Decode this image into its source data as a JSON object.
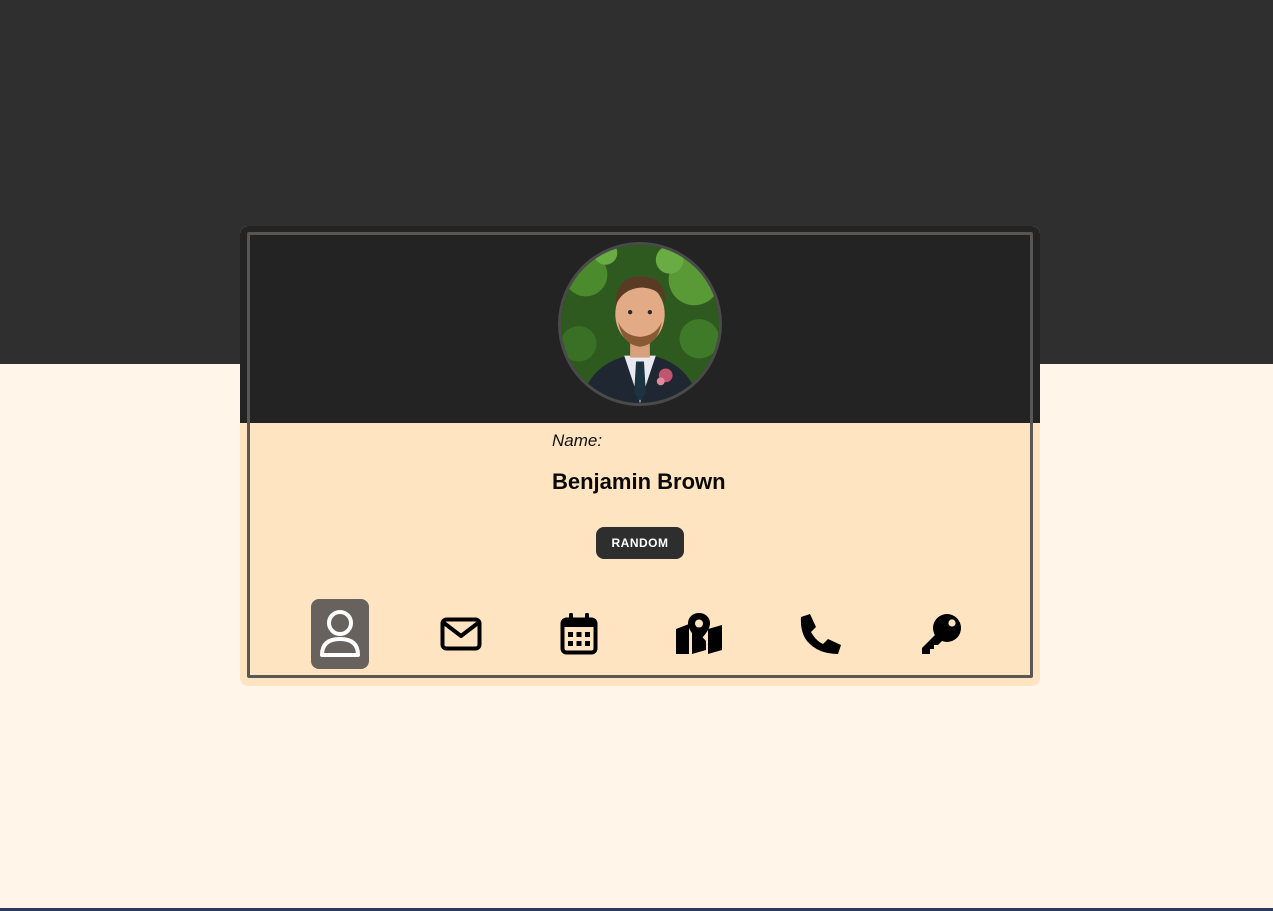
{
  "profile": {
    "label": "Name:",
    "value": "Benjamin Brown"
  },
  "random_button": {
    "label": "RANDOM"
  },
  "tabs": [
    {
      "icon": "user-icon",
      "active": true
    },
    {
      "icon": "envelope-icon",
      "active": false
    },
    {
      "icon": "calendar-icon",
      "active": false
    },
    {
      "icon": "map-icon",
      "active": false
    },
    {
      "icon": "phone-icon",
      "active": false
    },
    {
      "icon": "key-icon",
      "active": false
    }
  ],
  "colors": {
    "page_background": "#fff5e8",
    "top_band": "#2f2f2f",
    "card_body": "#ffe4c2",
    "card_header": "#232323",
    "button": "#2e2e2e",
    "active_tab": "#67625e"
  }
}
